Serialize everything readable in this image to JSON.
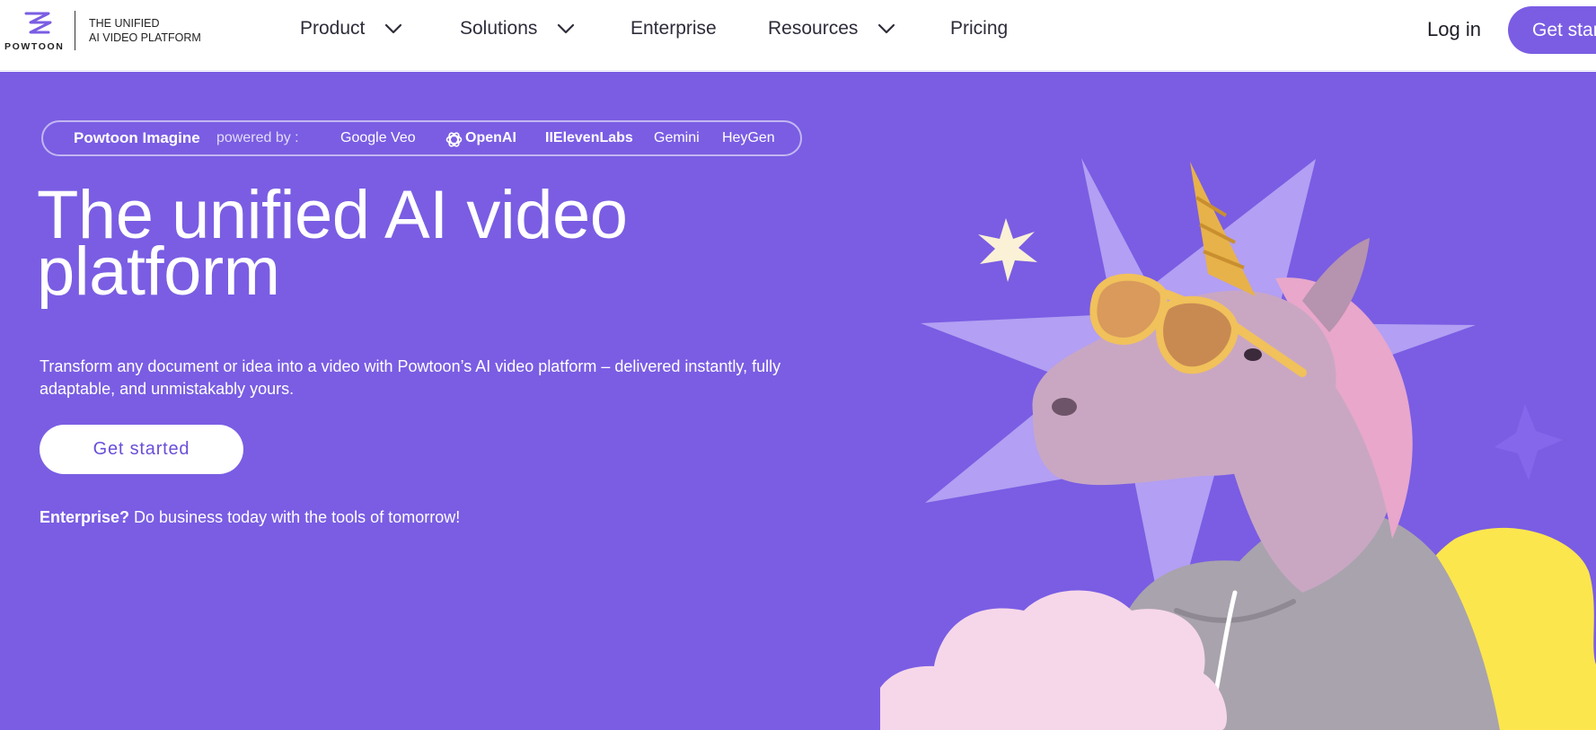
{
  "header": {
    "logo": {
      "wordmark": "POWTOON",
      "tagline_line1": "THE UNIFIED",
      "tagline_line2": "AI VIDEO PLATFORM"
    },
    "nav": [
      {
        "label": "Product",
        "dropdown": true
      },
      {
        "label": "Solutions",
        "dropdown": true
      },
      {
        "label": "Enterprise",
        "dropdown": false
      },
      {
        "label": "Resources",
        "dropdown": true
      },
      {
        "label": "Pricing",
        "dropdown": false
      }
    ],
    "login_label": "Log in",
    "cta_label": "Get started"
  },
  "hero": {
    "partners_bar": {
      "brand": "Powtoon Imagine",
      "powered_by": "powered by :",
      "partners": [
        "Google Veo",
        "OpenAI",
        "IIElevenLabs",
        "Gemini",
        "HeyGen"
      ]
    },
    "title": "The unified AI video platform",
    "subtitle": "Transform any document or idea into a video with Powtoon’s AI video platform – delivered instantly, fully adaptable, and unmistakably yours.",
    "cta_label": "Get started",
    "enterprise_bold": "Enterprise?",
    "enterprise_text": " Do business today with the tools of tomorrow!"
  },
  "colors": {
    "brand_purple": "#7a5de3",
    "white": "#ffffff",
    "star_lilac": "#b9a6f4",
    "star_cream": "#fbf1d6",
    "cloud_pink": "#f6d7e9",
    "accent_yellow": "#fbe64e",
    "horn_gold": "#e7b24a",
    "unicorn_mauve": "#c9a7c3",
    "hoodie_gray": "#a9a3ad"
  },
  "icons": [
    "powtoon-logo-icon",
    "chevron-down-icon",
    "openai-logo-icon"
  ],
  "illustration": "unicorn-with-sunglasses-in-hoodie"
}
